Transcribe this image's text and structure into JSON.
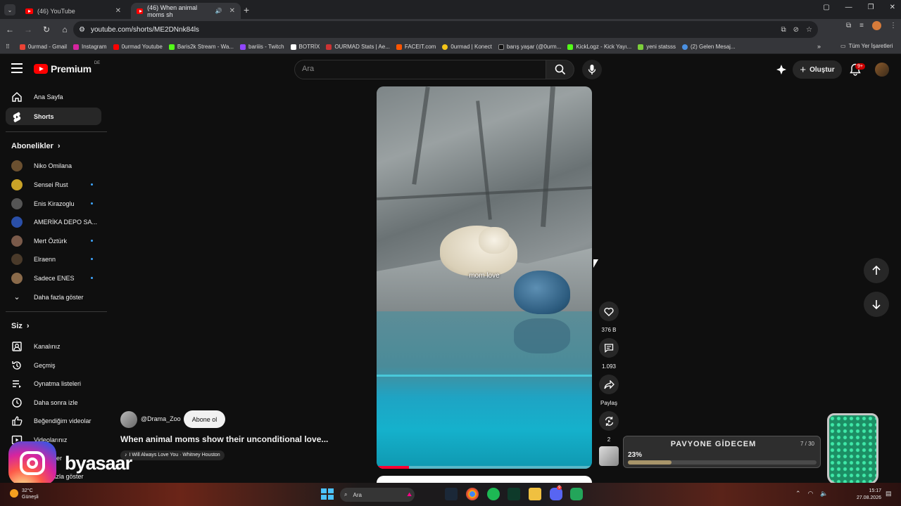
{
  "browser": {
    "tabs": [
      {
        "title": "(46) YouTube",
        "active": false
      },
      {
        "title": "(46) When animal moms sh",
        "active": true
      }
    ],
    "url": "youtube.com/shorts/ME2DNnk84ls",
    "bookmarks": [
      {
        "label": "0urmad - Gmail",
        "color": "#ea4335"
      },
      {
        "label": "Instagram",
        "color": "#d6249f"
      },
      {
        "label": "0urmad Youtube",
        "color": "#ff0000"
      },
      {
        "label": "Baris2k Stream - Wa...",
        "color": "#53fc18"
      },
      {
        "label": "bariiis - Twitch",
        "color": "#9146ff"
      },
      {
        "label": "BOTRİX",
        "color": "#ffffff"
      },
      {
        "label": "OURMAD Stats | Ae...",
        "color": "#c33"
      },
      {
        "label": "FACEIT.com",
        "color": "#ff5500"
      },
      {
        "label": "0urmad | Konect",
        "color": "#f5c518"
      },
      {
        "label": "barış yaşar (@0urm...",
        "color": "#000000"
      },
      {
        "label": "KickLogz - Kick Yayı...",
        "color": "#53fc18"
      },
      {
        "label": "yeni statsss",
        "color": "#7ccf3a"
      },
      {
        "label": "(2) Gelen Mesaj...",
        "color": "#4a90e2"
      }
    ],
    "bookmarks_all": "Tüm Yer İşaretleri"
  },
  "youtube": {
    "logo": "Premium",
    "logo_region": "DE",
    "search_placeholder": "Ara",
    "create_label": "Oluştur",
    "notif_count": "9+",
    "sidebar": {
      "home": "Ana Sayfa",
      "shorts": "Shorts",
      "subs_header": "Abonelikler",
      "subscriptions": [
        {
          "name": "Niko Omilana",
          "color": "#6b5030",
          "dot": false
        },
        {
          "name": "Sensei Rust",
          "color": "#c9a227",
          "dot": true
        },
        {
          "name": "Enis Kirazoglu",
          "color": "#555555",
          "dot": true
        },
        {
          "name": "AMERİKA DEPO SA...",
          "color": "#2a4fa8",
          "dot": false
        },
        {
          "name": "Mert Öztürk",
          "color": "#7a5a4a",
          "dot": true
        },
        {
          "name": "Elraenn",
          "color": "#4a3a2a",
          "dot": true
        },
        {
          "name": "Sadece ENES",
          "color": "#8a6a4a",
          "dot": true
        }
      ],
      "show_more": "Daha fazla göster",
      "you_header": "Siz",
      "you_items": [
        "Kanalınız",
        "Geçmiş",
        "Oynatma listeleri",
        "Daha sonra izle",
        "Beğendiğim videolar",
        "Videolarınız",
        "İndirmeler"
      ],
      "you_more": "Daha fazla göster"
    },
    "short": {
      "caption": "mom love",
      "progress": 0.15,
      "likes": "376 B",
      "comments": "1.093",
      "share": "Paylaş",
      "remix": "2",
      "channel": "@Drama_Zoo",
      "subscribe": "Abone ol",
      "title": "When animal moms show their unconditional love...",
      "music": "I Will Always Love You · Whitney Houston"
    }
  },
  "overlay": {
    "watermark": "byasaar",
    "widget_title": "PAVYONE GİDECEM",
    "widget_count": "7 / 30",
    "widget_percent": "23%",
    "widget_progress": 0.23
  },
  "taskbar": {
    "temp": "32°C",
    "condition": "Güneşli",
    "search": "Ara",
    "time": "15:17",
    "date": "27.08.2026",
    "discord_badge": "9"
  }
}
